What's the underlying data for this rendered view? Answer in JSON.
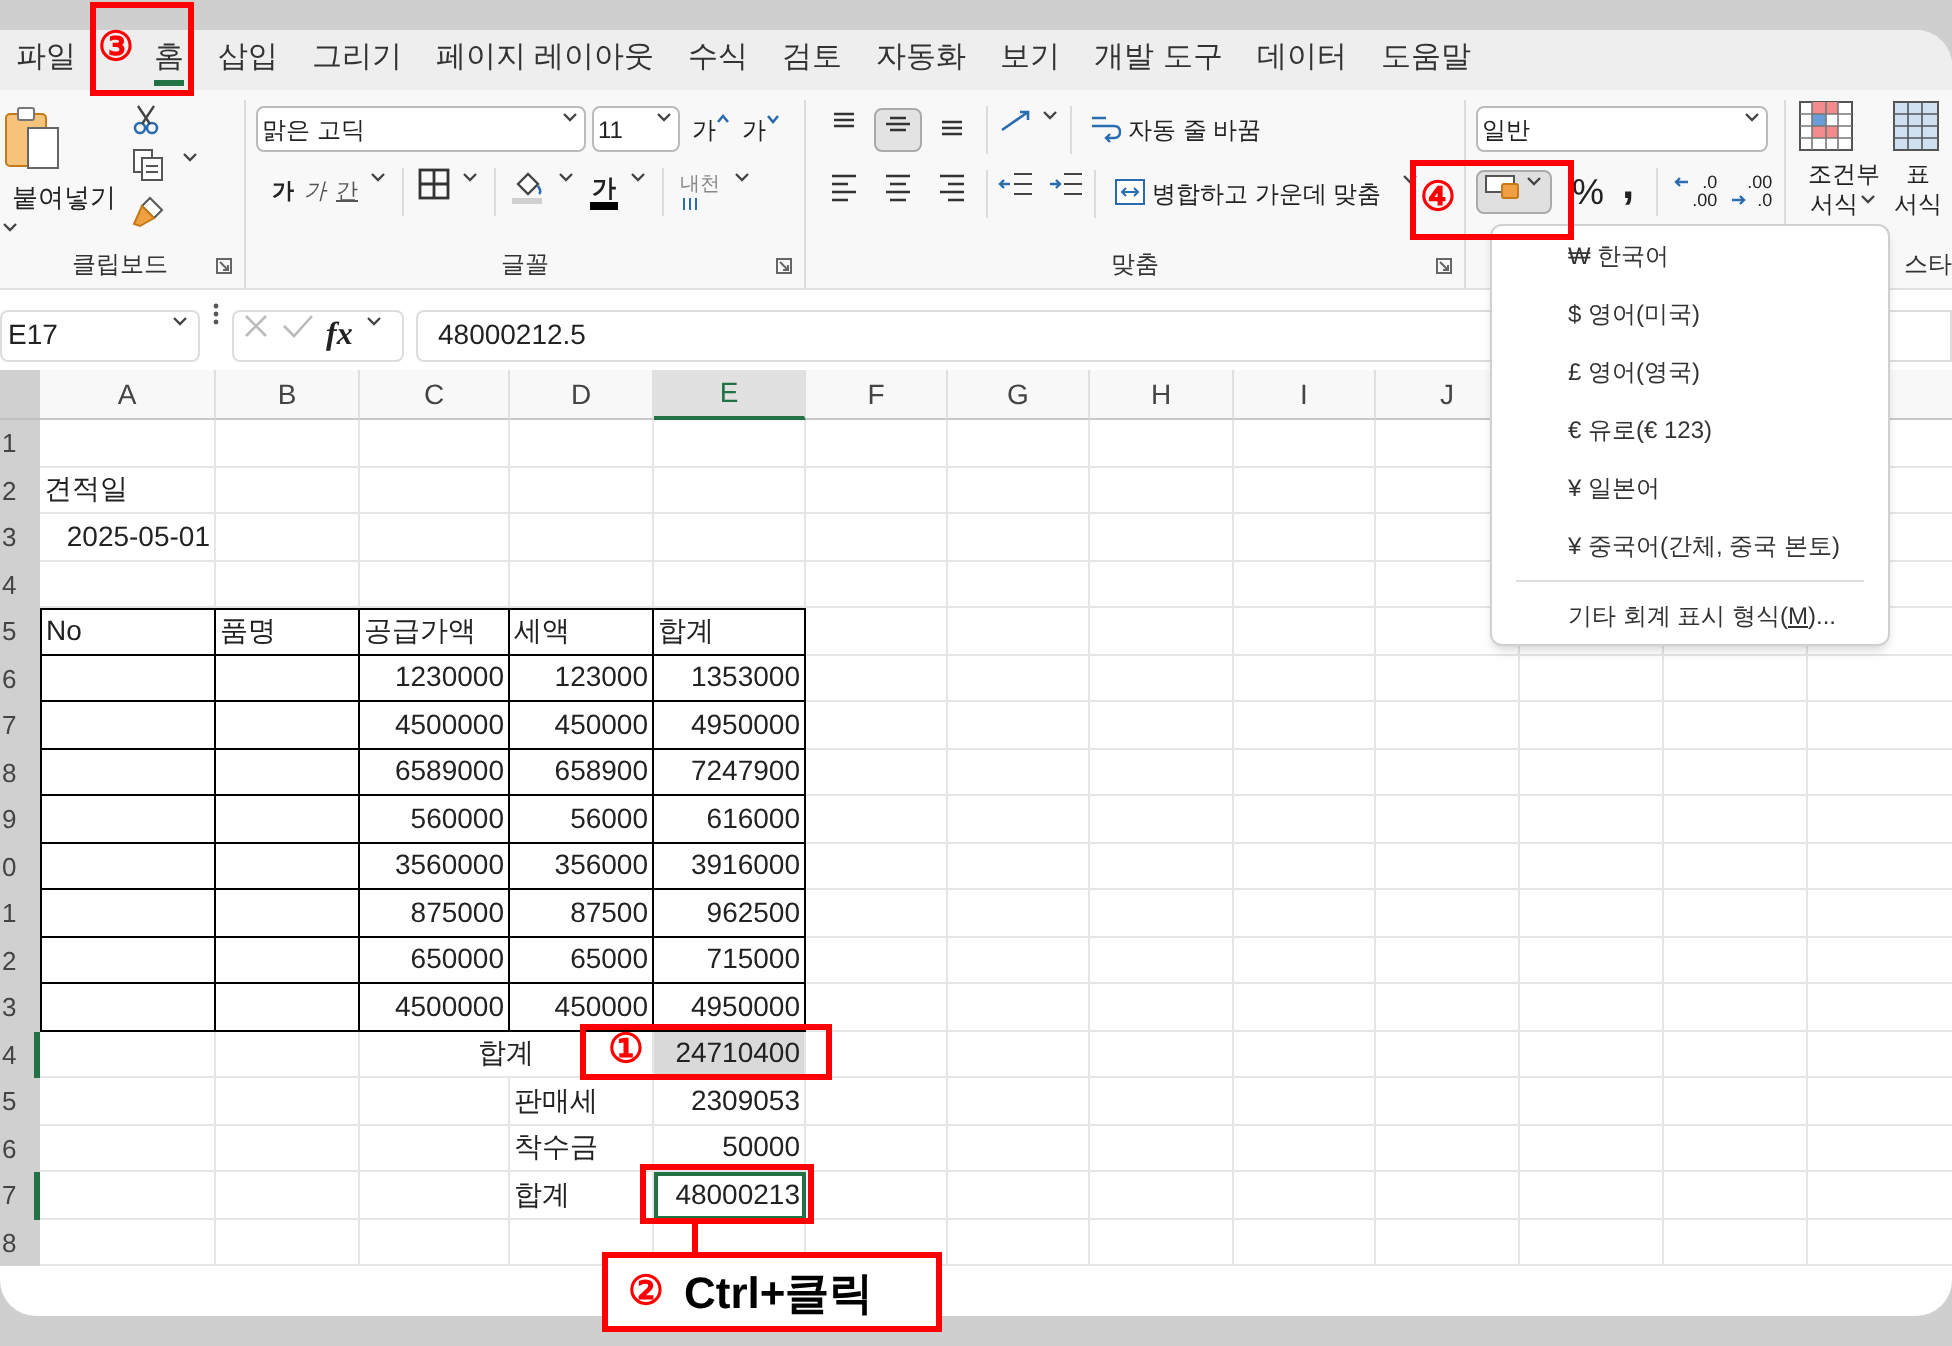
{
  "tabs": [
    {
      "label": "파일",
      "selected": false
    },
    {
      "label": "홈",
      "selected": true
    },
    {
      "label": "삽입",
      "selected": false
    },
    {
      "label": "그리기",
      "selected": false
    },
    {
      "label": "페이지 레이아웃",
      "selected": false
    },
    {
      "label": "수식",
      "selected": false
    },
    {
      "label": "검토",
      "selected": false
    },
    {
      "label": "자동화",
      "selected": false
    },
    {
      "label": "보기",
      "selected": false
    },
    {
      "label": "개발 도구",
      "selected": false
    },
    {
      "label": "데이터",
      "selected": false
    },
    {
      "label": "도움말",
      "selected": false
    }
  ],
  "ribbon": {
    "clipboard": {
      "paste": "붙여넣기",
      "group_label": "클립보드"
    },
    "font": {
      "font_name": "맑은 고딕",
      "font_size": "11",
      "grow": "가",
      "shrink": "가",
      "bold": "가",
      "italic": "가",
      "underline": "간",
      "font_color": "가",
      "phonetic": "내천",
      "group_label": "글꼴"
    },
    "alignment": {
      "vertical": [
        {
          "kind": "top",
          "selected": false
        },
        {
          "kind": "middle",
          "selected": true
        },
        {
          "kind": "bottom",
          "selected": false
        }
      ],
      "horizontal": [
        {
          "kind": "left",
          "selected": false
        },
        {
          "kind": "center",
          "selected": false
        },
        {
          "kind": "right",
          "selected": false
        }
      ],
      "wrap_text": "자동 줄 바꿈",
      "merge_center": "병합하고 가운데 맞춤",
      "group_label": "맞춤"
    },
    "number": {
      "format": "일반",
      "accounting_expanded": true,
      "percent": "%",
      "comma": ",",
      "increase_decimal": {
        "top": ".0",
        "bottom": ".00"
      },
      "decrease_decimal": {
        "top": ".00",
        "bottom": ".0"
      }
    },
    "styles": {
      "conditional_lines": [
        "조건부",
        "서식"
      ],
      "table_lines": [
        "표",
        "서식"
      ],
      "group_label": "스타"
    }
  },
  "formula_bar": {
    "name_box": "E17",
    "fx": "fx",
    "value": "48000212.5"
  },
  "sheet": {
    "columns": [
      {
        "label": "A",
        "selected": false
      },
      {
        "label": "B",
        "selected": false
      },
      {
        "label": "C",
        "selected": false
      },
      {
        "label": "D",
        "selected": false
      },
      {
        "label": "E",
        "selected": true
      },
      {
        "label": "F",
        "selected": false
      },
      {
        "label": "G",
        "selected": false
      },
      {
        "label": "H",
        "selected": false
      },
      {
        "label": "I",
        "selected": false
      },
      {
        "label": "J",
        "selected": false
      }
    ],
    "rows": [
      {
        "header": "1",
        "selected": false,
        "bordered": false,
        "cells": []
      },
      {
        "header": "2",
        "selected": false,
        "bordered": false,
        "cells": [
          {
            "kind": "text",
            "text": "견적일"
          }
        ]
      },
      {
        "header": "3",
        "selected": false,
        "bordered": false,
        "cells": [
          {
            "kind": "number",
            "text": "2025-05-01"
          }
        ]
      },
      {
        "header": "4",
        "selected": false,
        "bordered": false,
        "cells": []
      },
      {
        "header": "5",
        "selected": false,
        "bordered": true,
        "cells": [
          {
            "kind": "text",
            "text": "No"
          },
          {
            "kind": "text",
            "text": "품명"
          },
          {
            "kind": "text",
            "text": "공급가액"
          },
          {
            "kind": "text",
            "text": "세액"
          },
          {
            "kind": "text",
            "text": "합계"
          }
        ]
      },
      {
        "header": "6",
        "selected": false,
        "bordered": true,
        "cells": [
          "",
          "",
          {
            "kind": "number",
            "text": "1230000"
          },
          {
            "kind": "number",
            "text": "123000"
          },
          {
            "kind": "number",
            "text": "1353000"
          }
        ]
      },
      {
        "header": "7",
        "selected": false,
        "bordered": true,
        "cells": [
          "",
          "",
          {
            "kind": "number",
            "text": "4500000"
          },
          {
            "kind": "number",
            "text": "450000"
          },
          {
            "kind": "number",
            "text": "4950000"
          }
        ]
      },
      {
        "header": "8",
        "selected": false,
        "bordered": true,
        "cells": [
          "",
          "",
          {
            "kind": "number",
            "text": "6589000"
          },
          {
            "kind": "number",
            "text": "658900"
          },
          {
            "kind": "number",
            "text": "7247900"
          }
        ]
      },
      {
        "header": "9",
        "selected": false,
        "bordered": true,
        "cells": [
          "",
          "",
          {
            "kind": "number",
            "text": "560000"
          },
          {
            "kind": "number",
            "text": "56000"
          },
          {
            "kind": "number",
            "text": "616000"
          }
        ]
      },
      {
        "header": "0",
        "selected": false,
        "bordered": true,
        "cells": [
          "",
          "",
          {
            "kind": "number",
            "text": "3560000"
          },
          {
            "kind": "number",
            "text": "356000"
          },
          {
            "kind": "number",
            "text": "3916000"
          }
        ]
      },
      {
        "header": "1",
        "selected": false,
        "bordered": true,
        "cells": [
          "",
          "",
          {
            "kind": "number",
            "text": "875000"
          },
          {
            "kind": "number",
            "text": "87500"
          },
          {
            "kind": "number",
            "text": "962500"
          }
        ]
      },
      {
        "header": "2",
        "selected": false,
        "bordered": true,
        "cells": [
          "",
          "",
          {
            "kind": "number",
            "text": "650000"
          },
          {
            "kind": "number",
            "text": "65000"
          },
          {
            "kind": "number",
            "text": "715000"
          }
        ]
      },
      {
        "header": "3",
        "selected": false,
        "bordered": true,
        "cells": [
          "",
          "",
          {
            "kind": "number",
            "text": "4500000"
          },
          {
            "kind": "number",
            "text": "450000"
          },
          {
            "kind": "number",
            "text": "4950000"
          }
        ]
      },
      {
        "header": "4",
        "selected": true,
        "bordered": false,
        "cells": [
          "",
          "",
          {
            "kind": "merged",
            "text": "합계"
          },
          "",
          {
            "kind": "number",
            "text": "24710400",
            "selected": true,
            "active": false
          }
        ]
      },
      {
        "header": "5",
        "selected": false,
        "bordered": false,
        "cells": [
          "",
          "",
          "",
          {
            "kind": "text",
            "text": "판매세"
          },
          {
            "kind": "number",
            "text": "2309053"
          }
        ]
      },
      {
        "header": "6",
        "selected": false,
        "bordered": false,
        "cells": [
          "",
          "",
          "",
          {
            "kind": "text",
            "text": "착수금"
          },
          {
            "kind": "number",
            "text": "50000"
          }
        ]
      },
      {
        "header": "7",
        "selected": true,
        "bordered": false,
        "cells": [
          "",
          "",
          "",
          {
            "kind": "text",
            "text": "합계"
          },
          {
            "kind": "number",
            "text": "48000213",
            "selected": true,
            "active": true
          }
        ]
      },
      {
        "header": "8",
        "selected": false,
        "bordered": false,
        "cells": []
      }
    ]
  },
  "currency_menu": {
    "items": [
      {
        "symbol": "₩",
        "label": "한국어"
      },
      {
        "symbol": "$",
        "label": "영어(미국)"
      },
      {
        "symbol": "£",
        "label": "영어(영국)"
      },
      {
        "symbol": "€",
        "label": "유로(€ 123)"
      },
      {
        "symbol": "¥",
        "label": "일본어"
      },
      {
        "symbol": "¥",
        "label": "중국어(간체, 중국 본토)"
      }
    ],
    "more": {
      "before": "기타 회계 표시 형식(",
      "key": "M",
      "after": ")..."
    }
  },
  "annotations": [
    {
      "kind": "box",
      "marker": "③"
    },
    {
      "kind": "box",
      "marker": "④"
    },
    {
      "kind": "box",
      "marker": "①"
    },
    {
      "kind": "callout",
      "marker": "②",
      "text": "Ctrl+클릭"
    }
  ]
}
